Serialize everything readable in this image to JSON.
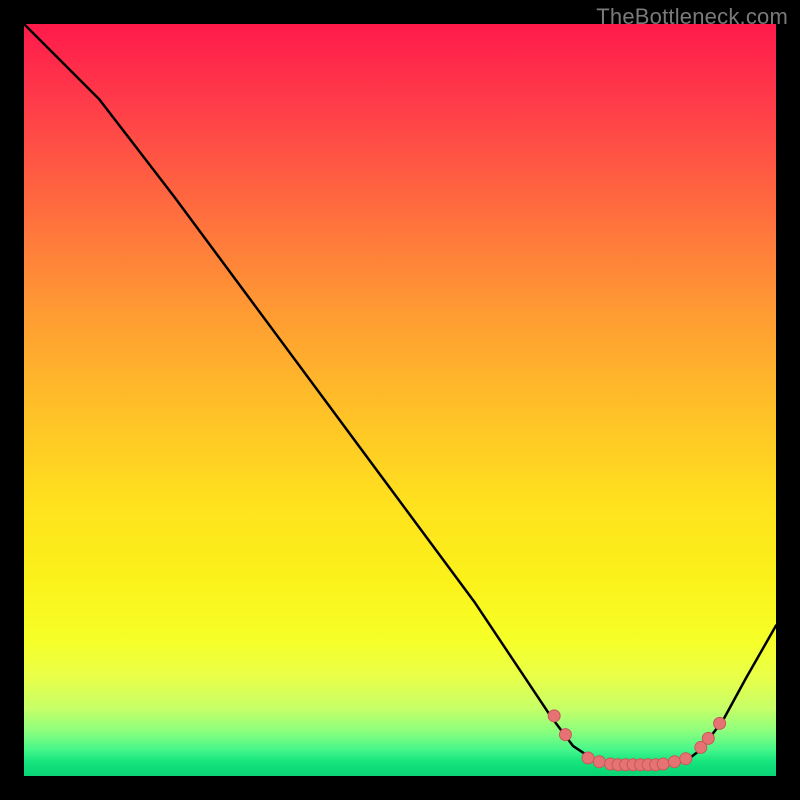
{
  "watermark": "TheBottleneck.com",
  "colors": {
    "curve": "#000000",
    "marker_fill": "#e57373",
    "marker_stroke": "#c85858"
  },
  "chart_data": {
    "type": "line",
    "title": "",
    "xlabel": "",
    "ylabel": "",
    "xlim": [
      0,
      100
    ],
    "ylim": [
      0,
      100
    ],
    "grid": false,
    "legend": false,
    "curve": [
      {
        "x": 0,
        "y": 100
      },
      {
        "x": 6,
        "y": 94
      },
      {
        "x": 10,
        "y": 90
      },
      {
        "x": 20,
        "y": 77
      },
      {
        "x": 30,
        "y": 63.5
      },
      {
        "x": 40,
        "y": 50
      },
      {
        "x": 50,
        "y": 36.5
      },
      {
        "x": 60,
        "y": 23
      },
      {
        "x": 66,
        "y": 14
      },
      {
        "x": 70,
        "y": 8
      },
      {
        "x": 73,
        "y": 4
      },
      {
        "x": 76,
        "y": 2
      },
      {
        "x": 80,
        "y": 1.5
      },
      {
        "x": 85,
        "y": 1.5
      },
      {
        "x": 88,
        "y": 2
      },
      {
        "x": 90,
        "y": 3.5
      },
      {
        "x": 93,
        "y": 7.5
      },
      {
        "x": 96,
        "y": 13
      },
      {
        "x": 100,
        "y": 20
      }
    ],
    "markers": [
      {
        "x": 70.5,
        "y": 8.0
      },
      {
        "x": 72.0,
        "y": 5.5
      },
      {
        "x": 75.0,
        "y": 2.4
      },
      {
        "x": 76.5,
        "y": 1.9
      },
      {
        "x": 78.0,
        "y": 1.6
      },
      {
        "x": 79.0,
        "y": 1.5
      },
      {
        "x": 80.0,
        "y": 1.5
      },
      {
        "x": 81.0,
        "y": 1.5
      },
      {
        "x": 82.0,
        "y": 1.5
      },
      {
        "x": 83.0,
        "y": 1.5
      },
      {
        "x": 84.0,
        "y": 1.5
      },
      {
        "x": 85.0,
        "y": 1.6
      },
      {
        "x": 86.5,
        "y": 1.9
      },
      {
        "x": 88.0,
        "y": 2.3
      },
      {
        "x": 90.0,
        "y": 3.8
      },
      {
        "x": 91.0,
        "y": 5.0
      },
      {
        "x": 92.5,
        "y": 7.0
      }
    ]
  }
}
